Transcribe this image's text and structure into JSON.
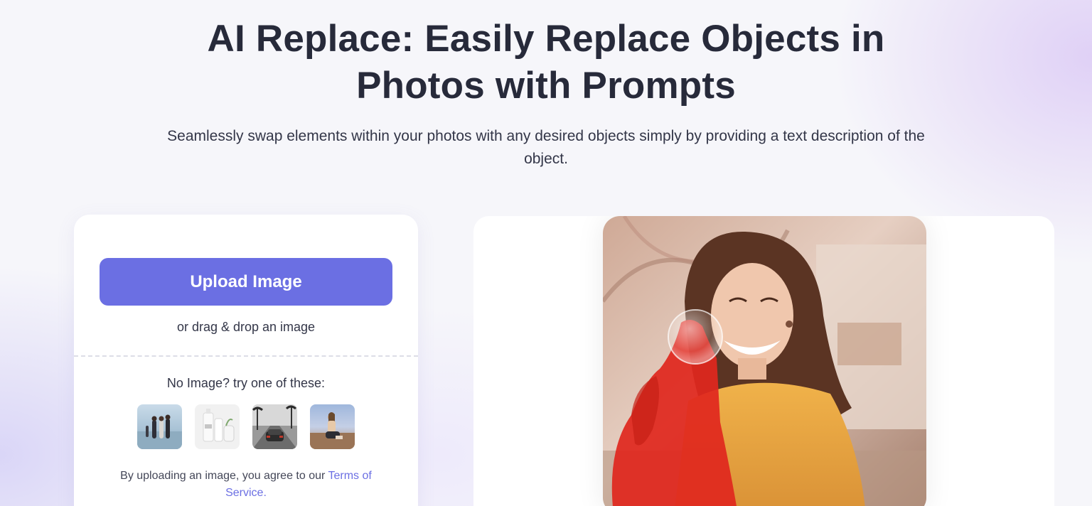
{
  "hero": {
    "title": "AI Replace: Easily Replace Objects in Photos with Prompts",
    "subtitle": "Seamlessly swap elements within your photos with any desired objects simply by providing a text description of the object."
  },
  "upload": {
    "button_label": "Upload Image",
    "drag_text": "or drag & drop an image",
    "try_text": "No Image? try one of these:",
    "samples": [
      {
        "icon": "beach-people-thumbnail"
      },
      {
        "icon": "product-bottles-thumbnail"
      },
      {
        "icon": "street-car-thumbnail"
      },
      {
        "icon": "woman-sitting-thumbnail"
      }
    ],
    "terms_prefix": "By uploading an image, you agree to our",
    "terms_link": "Terms of Service."
  },
  "colors": {
    "accent": "#6b6fe3",
    "title": "#272a3a",
    "mask": "#e0281e"
  }
}
